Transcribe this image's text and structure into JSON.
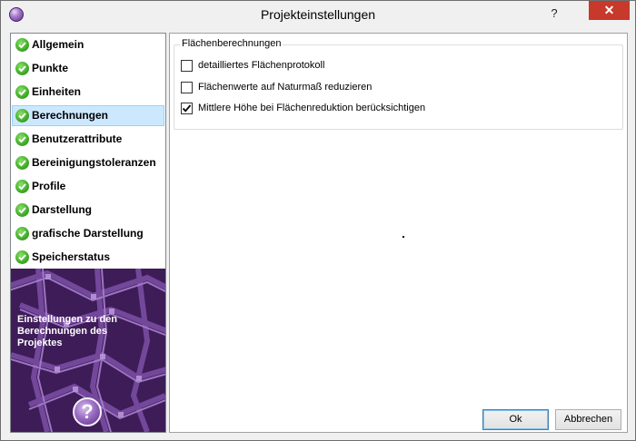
{
  "window": {
    "title": "Projekteinstellungen",
    "help_glyph": "?",
    "close_glyph": "✕",
    "app_icon": "app-orb-icon"
  },
  "nav": {
    "items": [
      {
        "label": "Allgemein",
        "selected": false
      },
      {
        "label": "Punkte",
        "selected": false
      },
      {
        "label": "Einheiten",
        "selected": false
      },
      {
        "label": "Berechnungen",
        "selected": true
      },
      {
        "label": "Benutzerattribute",
        "selected": false
      },
      {
        "label": "Bereinigungstoleranzen",
        "selected": false
      },
      {
        "label": "Profile",
        "selected": false
      },
      {
        "label": "Darstellung",
        "selected": false
      },
      {
        "label": "grafische Darstellung",
        "selected": false
      },
      {
        "label": "Speicherstatus",
        "selected": false
      }
    ],
    "description": "Einstellungen zu den Berechnungen des Projektes",
    "help_glyph": "?",
    "item_icon": "green-check-icon",
    "selected_color": "#cce8ff"
  },
  "group": {
    "title": "Flächenberechnungen",
    "options": [
      {
        "label": "detailliertes Flächenprotokoll",
        "checked": false
      },
      {
        "label": "Flächenwerte auf Naturmaß reduzieren",
        "checked": false
      },
      {
        "label": "Mittlere Höhe bei Flächenreduktion berücksichtigen",
        "checked": true
      }
    ]
  },
  "buttons": {
    "ok": "Ok",
    "cancel": "Abbrechen"
  },
  "colors": {
    "close_button": "#c7392b",
    "check_green": "#44b02b",
    "image_purple": "#3d1c57"
  }
}
